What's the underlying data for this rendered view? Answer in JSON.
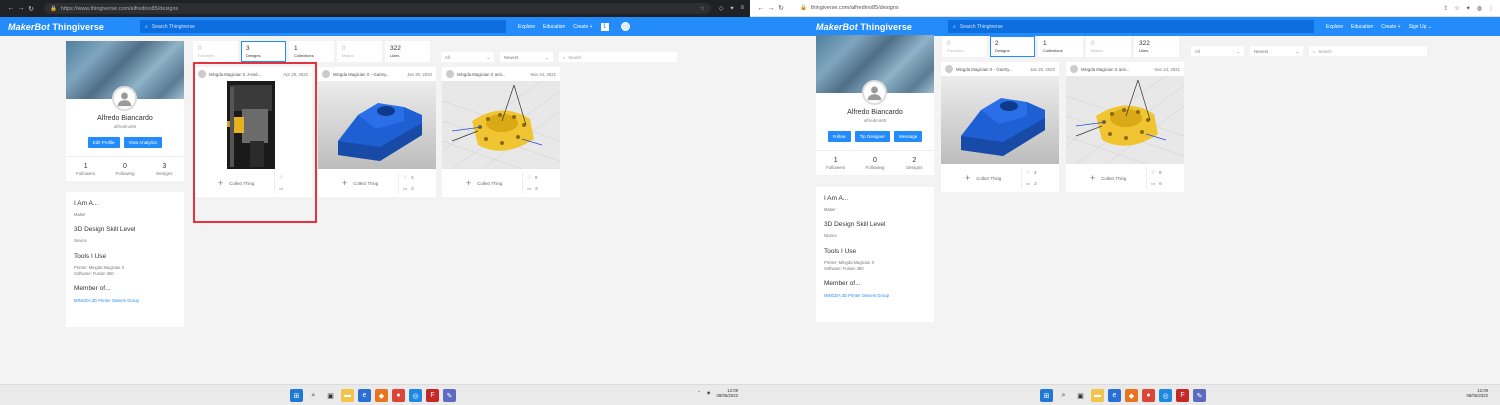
{
  "left": {
    "browser": {
      "url": "https://www.thingiverse.com/alfredino85/designs"
    },
    "header": {
      "logo_brand": "MakerBot",
      "logo_site": "Thingiverse",
      "search_placeholder": "Search Thingiverse",
      "links": [
        "Explore",
        "Education",
        "Create"
      ],
      "create_plus": "+",
      "badge": "1"
    },
    "profile": {
      "name": "Alfredo Biancardo",
      "handle": "alfredino85",
      "buttons": [
        "Edit Profile",
        "View Analytics"
      ],
      "stats": [
        {
          "value": "1",
          "label": "Followers"
        },
        {
          "value": "0",
          "label": "Following"
        },
        {
          "value": "3",
          "label": "Designs"
        }
      ]
    },
    "about": [
      {
        "heading": "I Am A...",
        "value": "Maker"
      },
      {
        "heading": "3D Design Skill Level",
        "value": "Novice"
      },
      {
        "heading": "Tools I Use",
        "value": "Printer: Mingda Magician X\nSoftware: Fusion 360"
      },
      {
        "heading": "Member of...",
        "link": "MINGDA 3D Printer Owners Group"
      }
    ],
    "tabs": [
      {
        "value": "0",
        "label": "Favorites"
      },
      {
        "value": "3",
        "label": "Designs"
      },
      {
        "value": "1",
        "label": "Collections"
      },
      {
        "value": "0",
        "label": "Makes"
      },
      {
        "value": "322",
        "label": "Likes"
      }
    ],
    "filters": {
      "type": "All",
      "sort": "Newest",
      "search_placeholder": "Search"
    },
    "things": [
      {
        "title": "Mingda Magician X J-end...",
        "date": "Apr 28, 2022",
        "collect": "Collect Thing",
        "likes": "",
        "comments": ""
      },
      {
        "title": "Mingda Magician X - Gantry...",
        "date": "Jan 20, 2022",
        "collect": "Collect Thing",
        "likes": "3",
        "comments": "2"
      },
      {
        "title": "Mingda Magician X anti...",
        "date": "Nov 24, 2021",
        "collect": "Collect Thing",
        "likes": "8",
        "comments": "6"
      }
    ],
    "taskbar": {
      "time": "12:09",
      "date": "08/05/2022"
    }
  },
  "right": {
    "browser": {
      "url": "thingiverse.com/alfredino85/designs"
    },
    "header": {
      "logo_brand": "MakerBot",
      "logo_site": "Thingiverse",
      "search_placeholder": "Search Thingiverse",
      "links": [
        "Explore",
        "Education",
        "Create",
        "Sign Up"
      ],
      "create_plus": "+"
    },
    "profile": {
      "name": "Alfredo Biancardo",
      "handle": "alfredino85",
      "buttons": [
        "Follow",
        "Tip Designer",
        "Message"
      ],
      "stats": [
        {
          "value": "1",
          "label": "Followers"
        },
        {
          "value": "0",
          "label": "Following"
        },
        {
          "value": "2",
          "label": "Designs"
        }
      ]
    },
    "about": [
      {
        "heading": "I Am A...",
        "value": "Maker"
      },
      {
        "heading": "3D Design Skill Level",
        "value": "Novice"
      },
      {
        "heading": "Tools I Use",
        "value": "Printer: Mingda Magician X\nSoftware: Fusion 360"
      },
      {
        "heading": "Member of...",
        "link": "MINGDA 3D Printer Owners Group"
      }
    ],
    "tabs": [
      {
        "value": "0",
        "label": "Favorites"
      },
      {
        "value": "2",
        "label": "Designs"
      },
      {
        "value": "1",
        "label": "Collections"
      },
      {
        "value": "0",
        "label": "Makes"
      },
      {
        "value": "322",
        "label": "Likes"
      }
    ],
    "filters": {
      "type": "All",
      "sort": "Newest",
      "search_placeholder": "Search"
    },
    "things": [
      {
        "title": "Mingda Magician X - Gantry...",
        "date": "Jan 20, 2022",
        "collect": "Collect Thing",
        "likes": "3",
        "comments": "2"
      },
      {
        "title": "Mingda Magician X anti...",
        "date": "Nov 24, 2021",
        "collect": "Collect Thing",
        "likes": "8",
        "comments": "6"
      }
    ],
    "taskbar": {
      "time": "12:09",
      "date": "08/05/2022"
    }
  },
  "colors": {
    "brand_blue": "#248bfb",
    "highlight_red": "#e2333e",
    "part_blue": "#1f5fd4",
    "part_yellow": "#f0c531"
  }
}
